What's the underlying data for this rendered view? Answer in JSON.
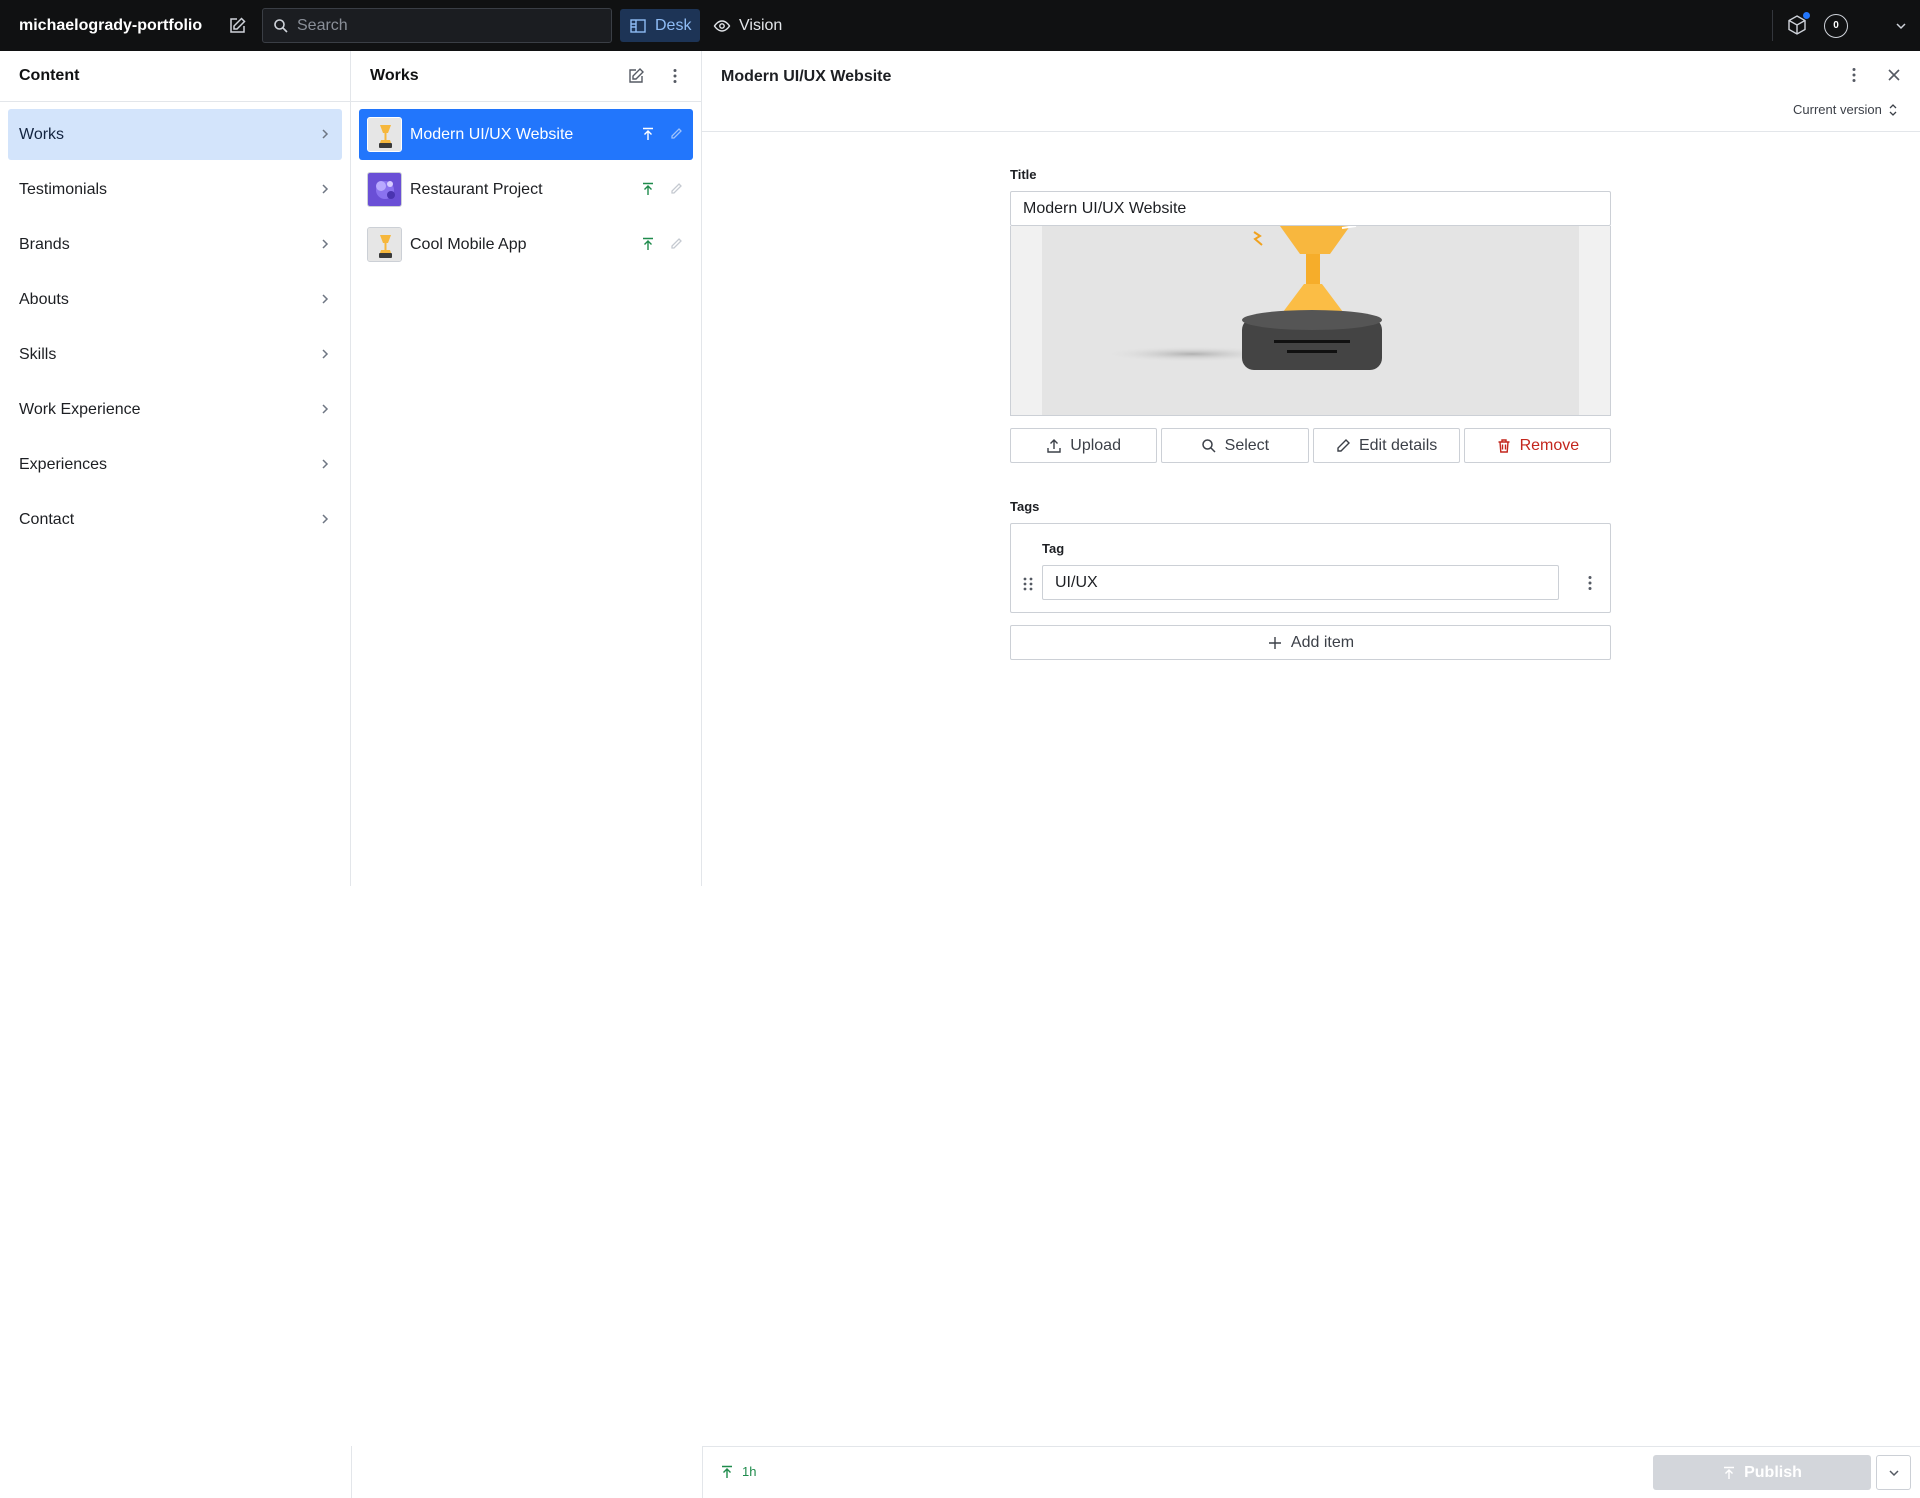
{
  "topbar": {
    "project_name": "michaelogrady-portfolio",
    "search_placeholder": "Search",
    "tools": [
      {
        "label": "Desk"
      },
      {
        "label": "Vision"
      }
    ],
    "notification_count": "0"
  },
  "content_pane": {
    "title": "Content",
    "items": [
      {
        "label": "Works"
      },
      {
        "label": "Testimonials"
      },
      {
        "label": "Brands"
      },
      {
        "label": "Abouts"
      },
      {
        "label": "Skills"
      },
      {
        "label": "Work Experience"
      },
      {
        "label": "Experiences"
      },
      {
        "label": "Contact"
      }
    ]
  },
  "works_pane": {
    "title": "Works",
    "documents": [
      {
        "title": "Modern UI/UX Website",
        "thumb": "trophy"
      },
      {
        "title": "Restaurant Project",
        "thumb": "purple-abstract"
      },
      {
        "title": "Cool Mobile App",
        "thumb": "trophy"
      }
    ]
  },
  "editor": {
    "doc_title": "Modern UI/UX Website",
    "version_label": "Current version",
    "fields": {
      "title_label": "Title",
      "title_value": "Modern UI/UX Website",
      "image_buttons": {
        "upload": "Upload",
        "select": "Select",
        "edit": "Edit details",
        "remove": "Remove"
      },
      "tags_label": "Tags",
      "tag_item_label": "Tag",
      "tag_value": "UI/UX",
      "add_item": "Add item"
    }
  },
  "footer": {
    "status_time": "1h",
    "publish_label": "Publish"
  },
  "colors": {
    "accent": "#2276fc",
    "selected_nav": "#d3e4fb",
    "published_green": "#1f8b4c",
    "danger": "#c3261d",
    "topbar_bg": "#101112"
  }
}
